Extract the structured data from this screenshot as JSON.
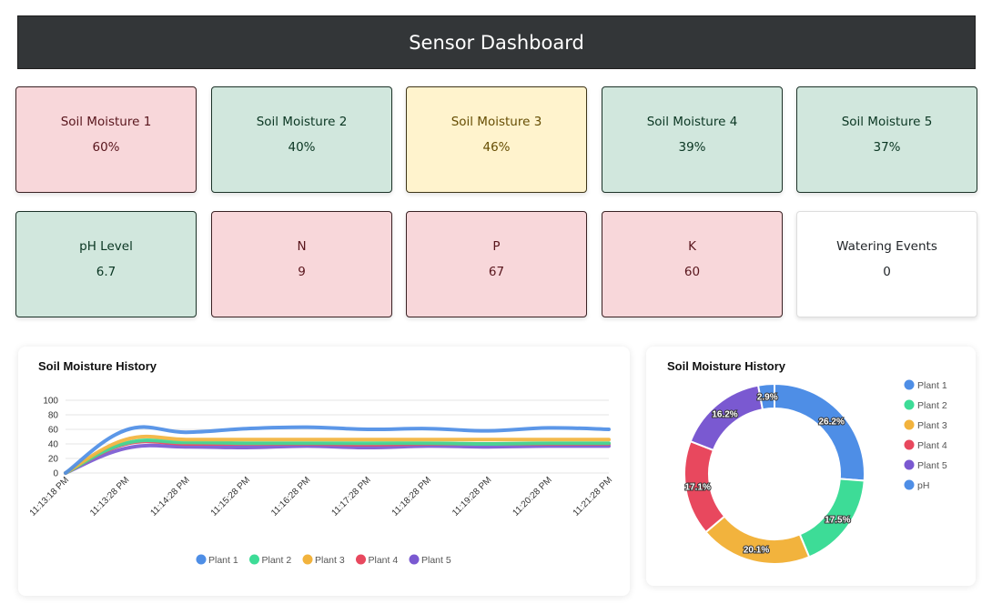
{
  "header": {
    "title": "Sensor Dashboard"
  },
  "cards": [
    {
      "title": "Soil Moisture 1",
      "value": "60%",
      "status": "red"
    },
    {
      "title": "Soil Moisture 2",
      "value": "40%",
      "status": "green"
    },
    {
      "title": "Soil Moisture 3",
      "value": "46%",
      "status": "yellow"
    },
    {
      "title": "Soil Moisture 4",
      "value": "39%",
      "status": "green"
    },
    {
      "title": "Soil Moisture 5",
      "value": "37%",
      "status": "green"
    },
    {
      "title": "pH Level",
      "value": "6.7",
      "status": "green"
    },
    {
      "title": "N",
      "value": "9",
      "status": "red"
    },
    {
      "title": "P",
      "value": "67",
      "status": "red"
    },
    {
      "title": "K",
      "value": "60",
      "status": "red"
    },
    {
      "title": "Watering Events",
      "value": "0",
      "status": "white"
    }
  ],
  "line_panel": {
    "title": "Soil Moisture History"
  },
  "donut_panel": {
    "title": "Soil Moisture History"
  },
  "colors": {
    "plant1": "#4e8ee6",
    "plant2": "#3ddc97",
    "plant3": "#f2b33d",
    "plant4": "#e8485e",
    "plant5": "#7a59d1",
    "ph": "#4e8ee6"
  },
  "chart_data": [
    {
      "type": "line",
      "title": "Soil Moisture History",
      "x": [
        "11:13:18 PM",
        "11:13:28 PM",
        "11:14:28 PM",
        "11:15:28 PM",
        "11:16:28 PM",
        "11:17:28 PM",
        "11:18:28 PM",
        "11:19:28 PM",
        "11:20:28 PM",
        "11:21:28 PM"
      ],
      "x_display": [
        "11:13:18 PM",
        "11:13:28 PM",
        "11:14:28 PM",
        "11:15:28 PM",
        "11:16:28 PM",
        "11:17:28 PM",
        "11:18:28 PM",
        "11:19:28 PM",
        "11:20:28 PM",
        "11:21:28 PM"
      ],
      "ylim": [
        0,
        100
      ],
      "yticks": [
        0,
        20,
        40,
        60,
        80,
        100
      ],
      "ytick_labels": [
        "0",
        "20",
        "40",
        "60",
        "80",
        "100"
      ],
      "grid": true,
      "legend": "bottom",
      "series": [
        {
          "name": "Plant 1",
          "color": "#4e8ee6",
          "values": [
            0,
            59,
            56,
            61,
            63,
            60,
            61,
            58,
            62,
            60
          ]
        },
        {
          "name": "Plant 2",
          "color": "#3ddc97",
          "values": [
            0,
            41,
            42,
            41,
            41,
            41,
            41,
            40,
            41,
            41
          ]
        },
        {
          "name": "Plant 3",
          "color": "#f2b33d",
          "values": [
            0,
            46,
            46,
            46,
            46,
            46,
            46,
            46,
            46,
            46
          ]
        },
        {
          "name": "Plant 4",
          "color": "#e8485e",
          "values": [
            0,
            40,
            40,
            40,
            40,
            39,
            40,
            40,
            40,
            40
          ]
        },
        {
          "name": "Plant 5",
          "color": "#7a59d1",
          "values": [
            0,
            34,
            36,
            35,
            37,
            35,
            37,
            36,
            37,
            37
          ]
        }
      ]
    },
    {
      "type": "pie",
      "title": "Soil Moisture History",
      "legend": "right",
      "labels": [
        "Plant 1",
        "Plant 2",
        "Plant 3",
        "Plant 4",
        "Plant 5",
        "pH"
      ],
      "values": [
        26.2,
        17.5,
        20.1,
        17.1,
        16.2,
        2.9
      ],
      "value_labels": [
        "26.2%",
        "17.5%",
        "20.1%",
        "17.1%",
        "16.2%",
        "2.9%"
      ],
      "colors": [
        "#4e8ee6",
        "#3ddc97",
        "#f2b33d",
        "#e8485e",
        "#7a59d1",
        "#4e8ee6"
      ]
    }
  ]
}
